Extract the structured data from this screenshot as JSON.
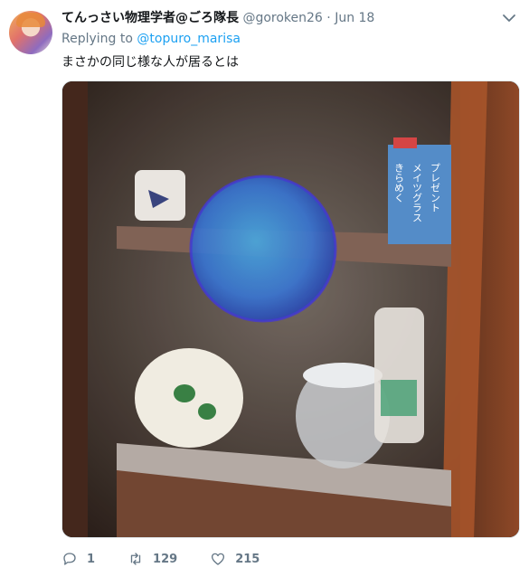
{
  "tweet": {
    "display_name": "てんっさい物理学者@ごろ隊長",
    "handle": "@goroken26",
    "separator": "·",
    "date": "Jun 18",
    "replying_prefix": "Replying to",
    "replying_to": "@topuro_marisa",
    "text": "まさかの同じ様な人が居るとは",
    "photo_text": [
      "きらめく",
      "メイツグラス",
      "プレゼント"
    ]
  },
  "actions": {
    "reply_count": "1",
    "retweet_count": "129",
    "like_count": "215"
  },
  "colors": {
    "link": "#1da1f2",
    "secondary": "#657786",
    "primary": "#14171a"
  }
}
